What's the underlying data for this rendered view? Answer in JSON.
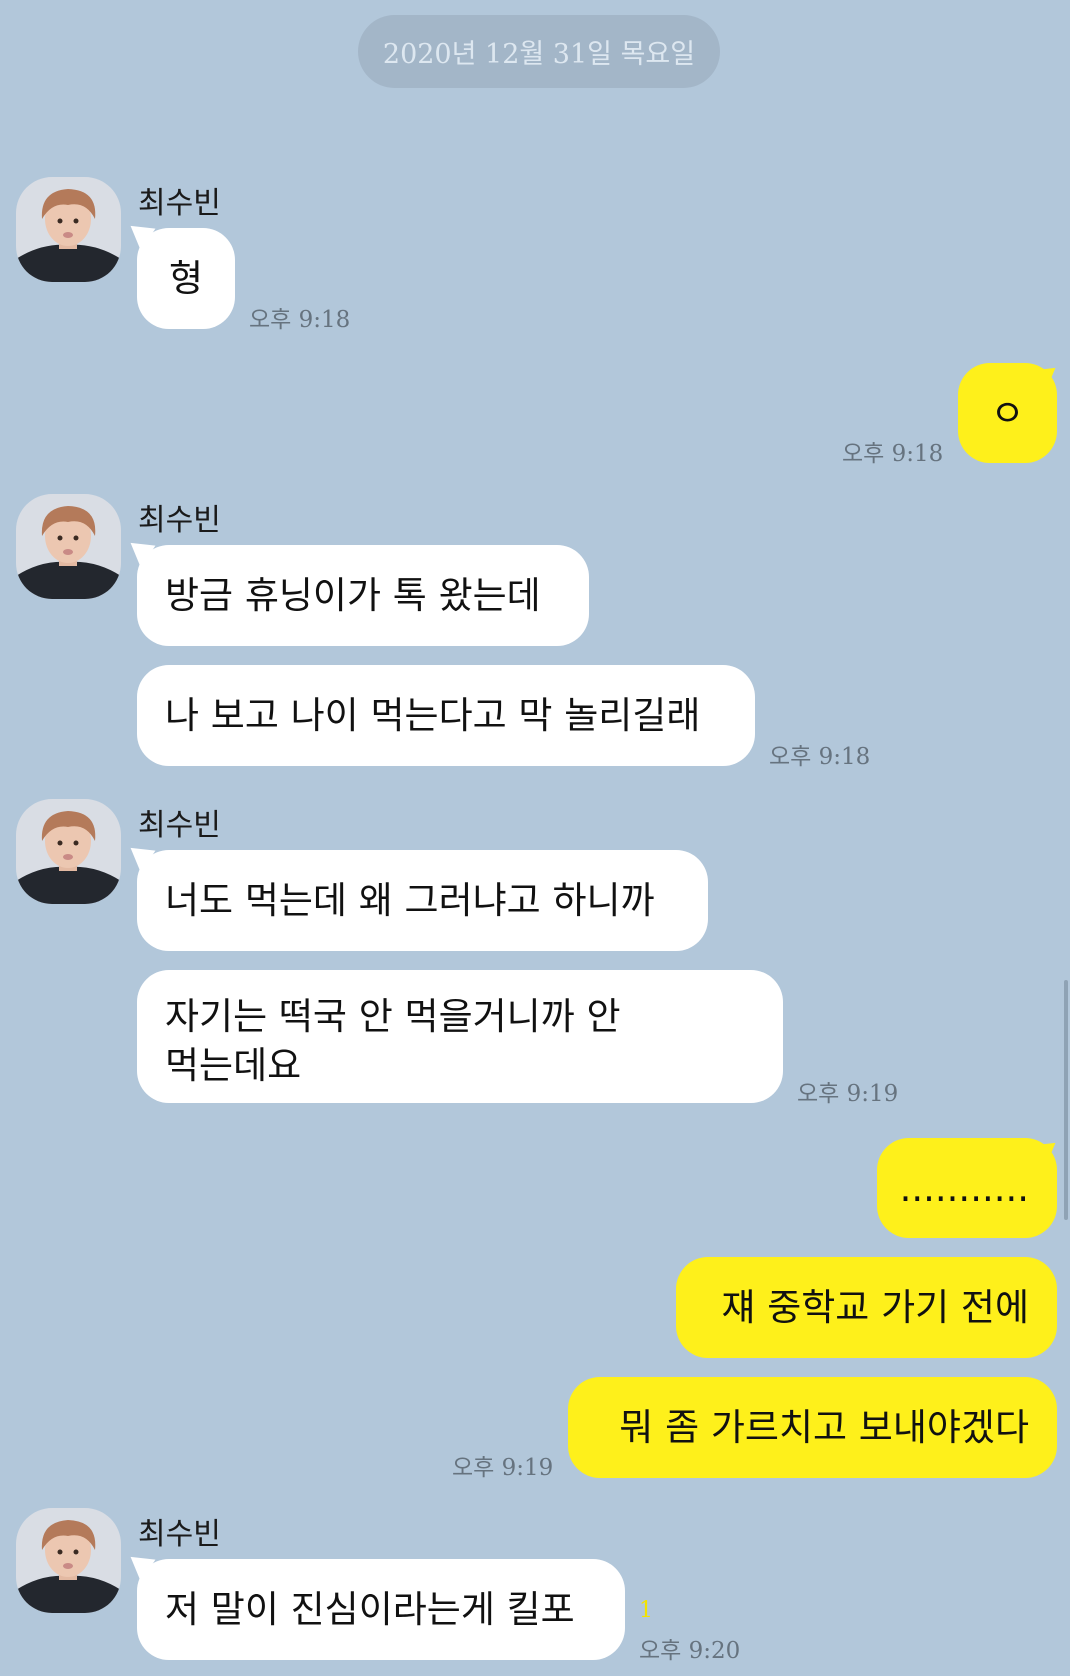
{
  "chat": {
    "date_divider": "2020년 12월 31일 목요일",
    "groups": [
      {
        "sender": "최수빈",
        "messages": [
          "형"
        ],
        "time": "오후 9:18"
      },
      {
        "sender": "me",
        "messages": [
          "ㅇ"
        ],
        "time": "오후 9:18"
      },
      {
        "sender": "최수빈",
        "messages": [
          "방금 휴닝이가 톡 왔는데",
          "나 보고 나이 먹는다고 막 놀리길래"
        ],
        "time": "오후 9:18"
      },
      {
        "sender": "최수빈",
        "messages": [
          "너도 먹는데 왜 그러냐고 하니까",
          "자기는 떡국 안 먹을거니까 안 먹는데요"
        ],
        "time": "오후 9:19"
      },
      {
        "sender": "me",
        "messages": [
          "...........",
          "쟤 중학교 가기 전에",
          "뭐 좀 가르치고 보내야겠다"
        ],
        "time": "오후 9:19"
      },
      {
        "sender": "최수빈",
        "messages": [
          "저 말이 진심이라는게 킬포"
        ],
        "time": "오후 9:20",
        "unread_count": "1"
      }
    ]
  },
  "colors": {
    "background": "#b2c7da",
    "my_bubble": "#fef01b",
    "their_bubble": "#ffffff",
    "date_pill": "#a3b6c8"
  },
  "icons": {
    "avatar": "profile-photo-icon"
  }
}
